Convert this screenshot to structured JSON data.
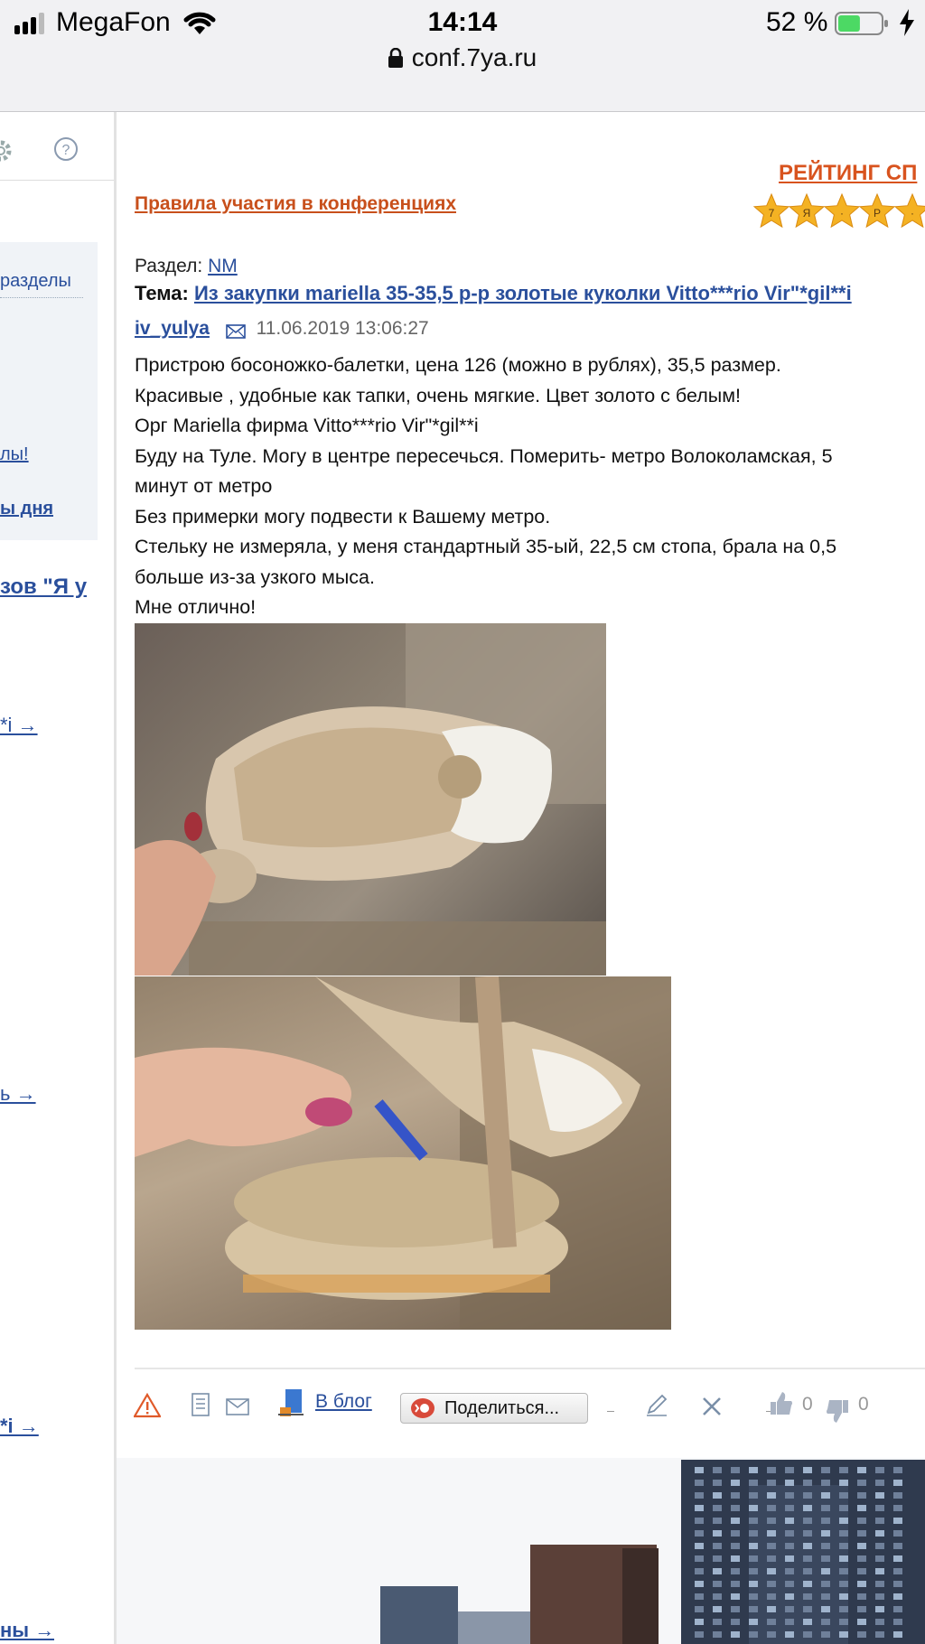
{
  "status_bar": {
    "carrier": "MegaFon",
    "time": "14:14",
    "battery_percent": "52 %",
    "battery_level": 0.52,
    "url": "conf.7ya.ru"
  },
  "sidebar": {
    "razdely": "разделы",
    "link1": "лы!",
    "link2": "ы дня",
    "big_link": "зов \"Я у",
    "arrow1": "*i →",
    "arrow2": "ь →",
    "arrow3": "*i →",
    "arrow4": "ны →"
  },
  "header": {
    "rating_title": "РЕЙТИНГ СП",
    "rating_star_letters": [
      "7",
      "Я",
      "·",
      "Р",
      "·"
    ],
    "rules_link": "Правила участия в конференциях"
  },
  "post": {
    "section_label": "Раздел:",
    "section_value": "NM",
    "topic_label": "Тема:",
    "topic_value": "Из закупки mariella 35-35,5 р-р золотые куколки Vitto***rio Vir\"*gil**i",
    "author": "iv_yulya",
    "date": "11.06.2019 13:06:27",
    "body_lines": [
      "Пристрою босоножко-балетки, цена 126 (можно в рублях), 35,5 размер.",
      "Красивые , удобные как тапки, очень мягкие. Цвет золото с белым!",
      "Орг Mariella фирма Vitto***rio Vir\"*gil**i",
      "Буду на Туле. Могу в центре пересечься. Померить- метро Волоколамская, 5",
      "минут от метро",
      "Без примерки могу подвести к Вашему метро.",
      "Стельку не измеряла, у меня стандартный 35-ый, 22,5 см стопа, брала на 0,5",
      "больше из-за узкого мыса.",
      "Мне отлично!"
    ]
  },
  "actions": {
    "blog_label": "В блог",
    "share_label": "Поделиться...",
    "likes": "0",
    "dislikes": "0"
  },
  "colors": {
    "link_blue": "#2a4f9c",
    "rules_orange": "#c8501c",
    "rating_orange": "#d8531e",
    "battery_green": "#4cd964"
  }
}
